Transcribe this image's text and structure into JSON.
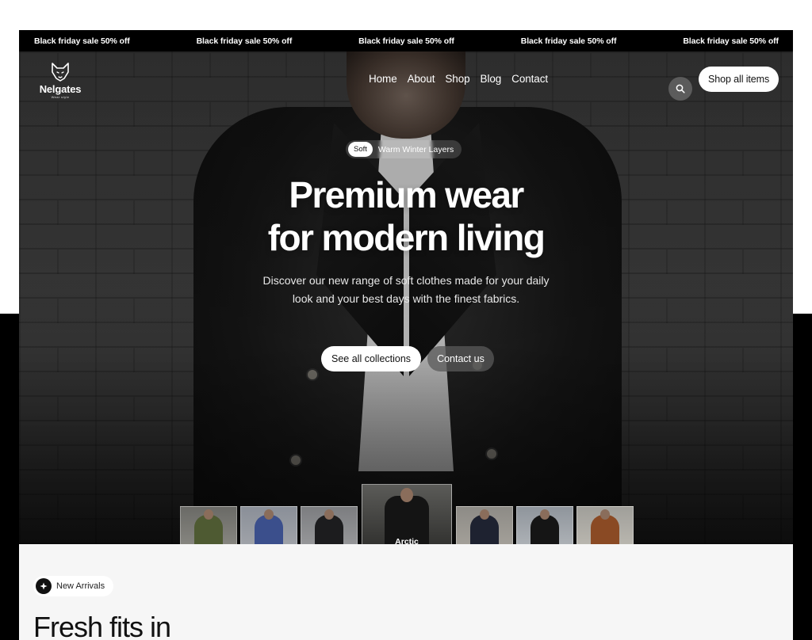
{
  "ticker": {
    "items": [
      "Black friday sale 50% off",
      "Black friday sale 50% off",
      "Black friday sale 50% off",
      "Black friday sale 50% off",
      "Black friday sale 50% off"
    ]
  },
  "nav": {
    "logo_name": "Nelgates",
    "logo_tagline": "Wear style",
    "links": [
      "Home",
      "About",
      "Shop",
      "Blog",
      "Contact"
    ],
    "search_icon": "search-icon",
    "shop_all_label": "Shop all items"
  },
  "hero": {
    "pill_chip": "Soft",
    "pill_text": "Warm Winter Layers",
    "title_line1": "Premium wear",
    "title_line2": "for modern living",
    "subtitle_line1": "Discover our new range of soft clothes made for your daily",
    "subtitle_line2": "look and your best days with the finest fabrics.",
    "primary_cta": "See all collections",
    "secondary_cta": "Contact us"
  },
  "thumbnails": [
    {
      "caption": "",
      "color": "#4e5a32"
    },
    {
      "caption": "",
      "color": "#3b4f8c"
    },
    {
      "caption": "",
      "color": "#1c1c1e"
    },
    {
      "caption": "Arctic",
      "color": "#141414"
    },
    {
      "caption": "",
      "color": "#1e2230"
    },
    {
      "caption": "",
      "color": "#151515"
    },
    {
      "caption": "",
      "color": "#8a4a24"
    }
  ],
  "section": {
    "badge_label": "New Arrivals",
    "heading": "Fresh fits in"
  },
  "colors": {
    "ticker_bg": "#000000",
    "primary_button_bg": "#ffffff",
    "section_bg": "#f6f6f6"
  }
}
